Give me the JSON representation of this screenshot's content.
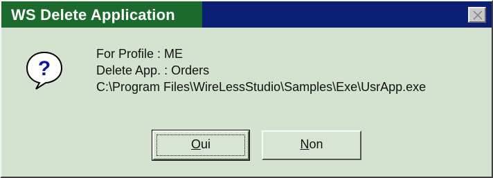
{
  "window": {
    "title": "WS Delete Application"
  },
  "icons": {
    "close": "close-icon",
    "question": "question-icon"
  },
  "message": {
    "line1": "For Profile : ME",
    "line2": "Delete App. : Orders",
    "line3": "C:\\Program Files\\WireLessStudio\\Samples\\Exe\\UsrApp.exe"
  },
  "buttons": {
    "oui_mnemonic": "O",
    "oui_rest": "ui",
    "non_mnemonic": "N",
    "non_rest": "on"
  },
  "colors": {
    "titlebar": "#0b1f73",
    "dialog_bg": "#d4e3d0"
  }
}
